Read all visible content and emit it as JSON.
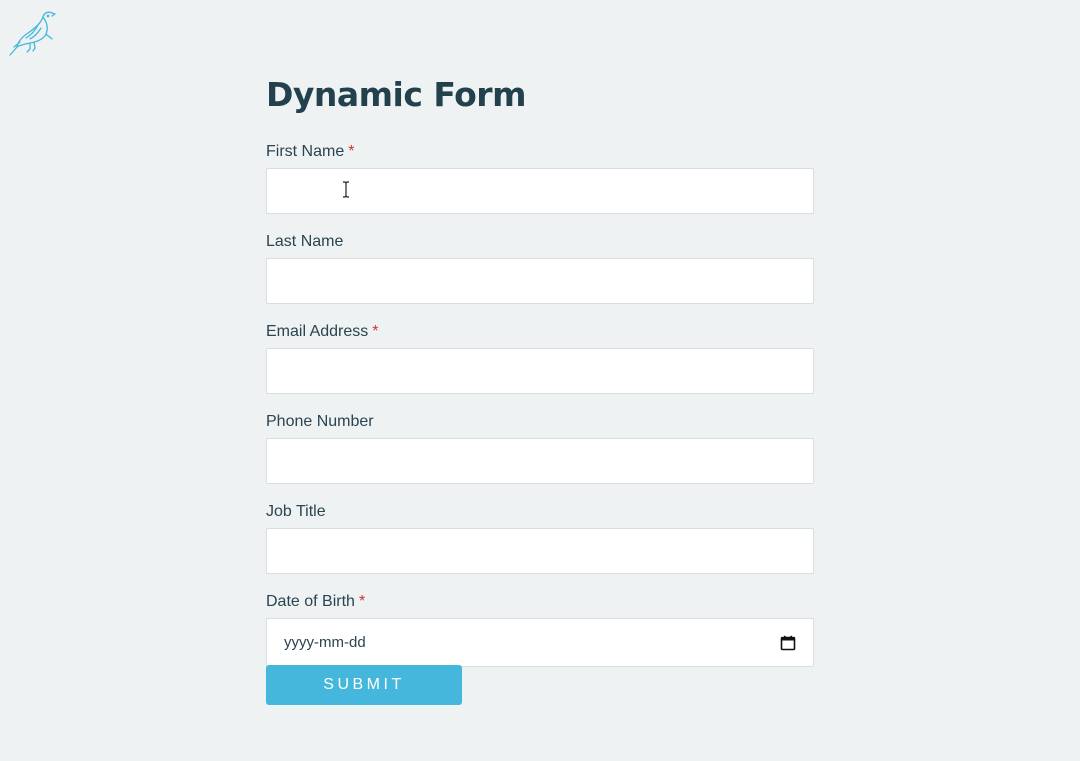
{
  "logo": {
    "icon": "bird-logo-icon",
    "color": "#45b7dc"
  },
  "form": {
    "title": "Dynamic Form",
    "fields": [
      {
        "label": "First Name",
        "required": true,
        "value": "",
        "type": "text"
      },
      {
        "label": "Last Name",
        "required": false,
        "value": "",
        "type": "text"
      },
      {
        "label": "Email Address",
        "required": true,
        "value": "",
        "type": "email"
      },
      {
        "label": "Phone Number",
        "required": false,
        "value": "",
        "type": "tel"
      },
      {
        "label": "Job Title",
        "required": false,
        "value": "",
        "type": "text"
      },
      {
        "label": "Date of Birth",
        "required": true,
        "placeholder": "yyyy-mm-dd",
        "type": "date",
        "icon": "calendar-icon"
      }
    ],
    "required_marker": "*",
    "submit_label": "SUBMIT"
  },
  "colors": {
    "background": "#eef2f3",
    "accent": "#45b7dc",
    "required": "#d0342c",
    "text": "#22414d"
  }
}
